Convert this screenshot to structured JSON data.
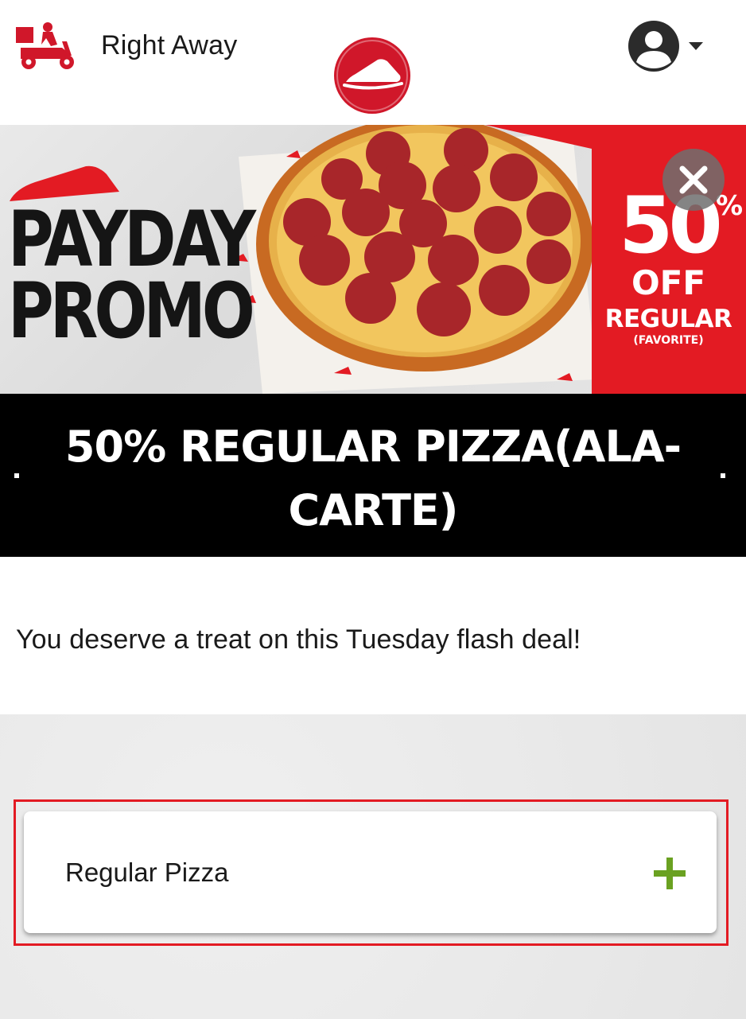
{
  "header": {
    "delivery_mode_label": "Right Away",
    "delivery_icon": "delivery-scooter-icon",
    "logo_icon": "pizza-hut-logo",
    "account_icon": "user-account-icon",
    "account_caret_icon": "caret-down-icon"
  },
  "banner": {
    "promo_line_1": "PAYDAY",
    "promo_line_2": "PROMO",
    "discount_value": "50",
    "discount_symbol": "%",
    "discount_off": "OFF",
    "discount_regular": "REGULAR",
    "discount_favorite": "(FAVORITE)",
    "close_icon": "close-icon",
    "brand_red": "#e31b23"
  },
  "deal": {
    "title": "50% REGULAR PIZZA(ALA-CARTE)",
    "description": "You deserve a treat on this Tuesday flash deal!"
  },
  "items": {
    "regular_pizza_label": "Regular Pizza",
    "add_icon": "plus-icon",
    "add_icon_color": "#6aa121"
  }
}
